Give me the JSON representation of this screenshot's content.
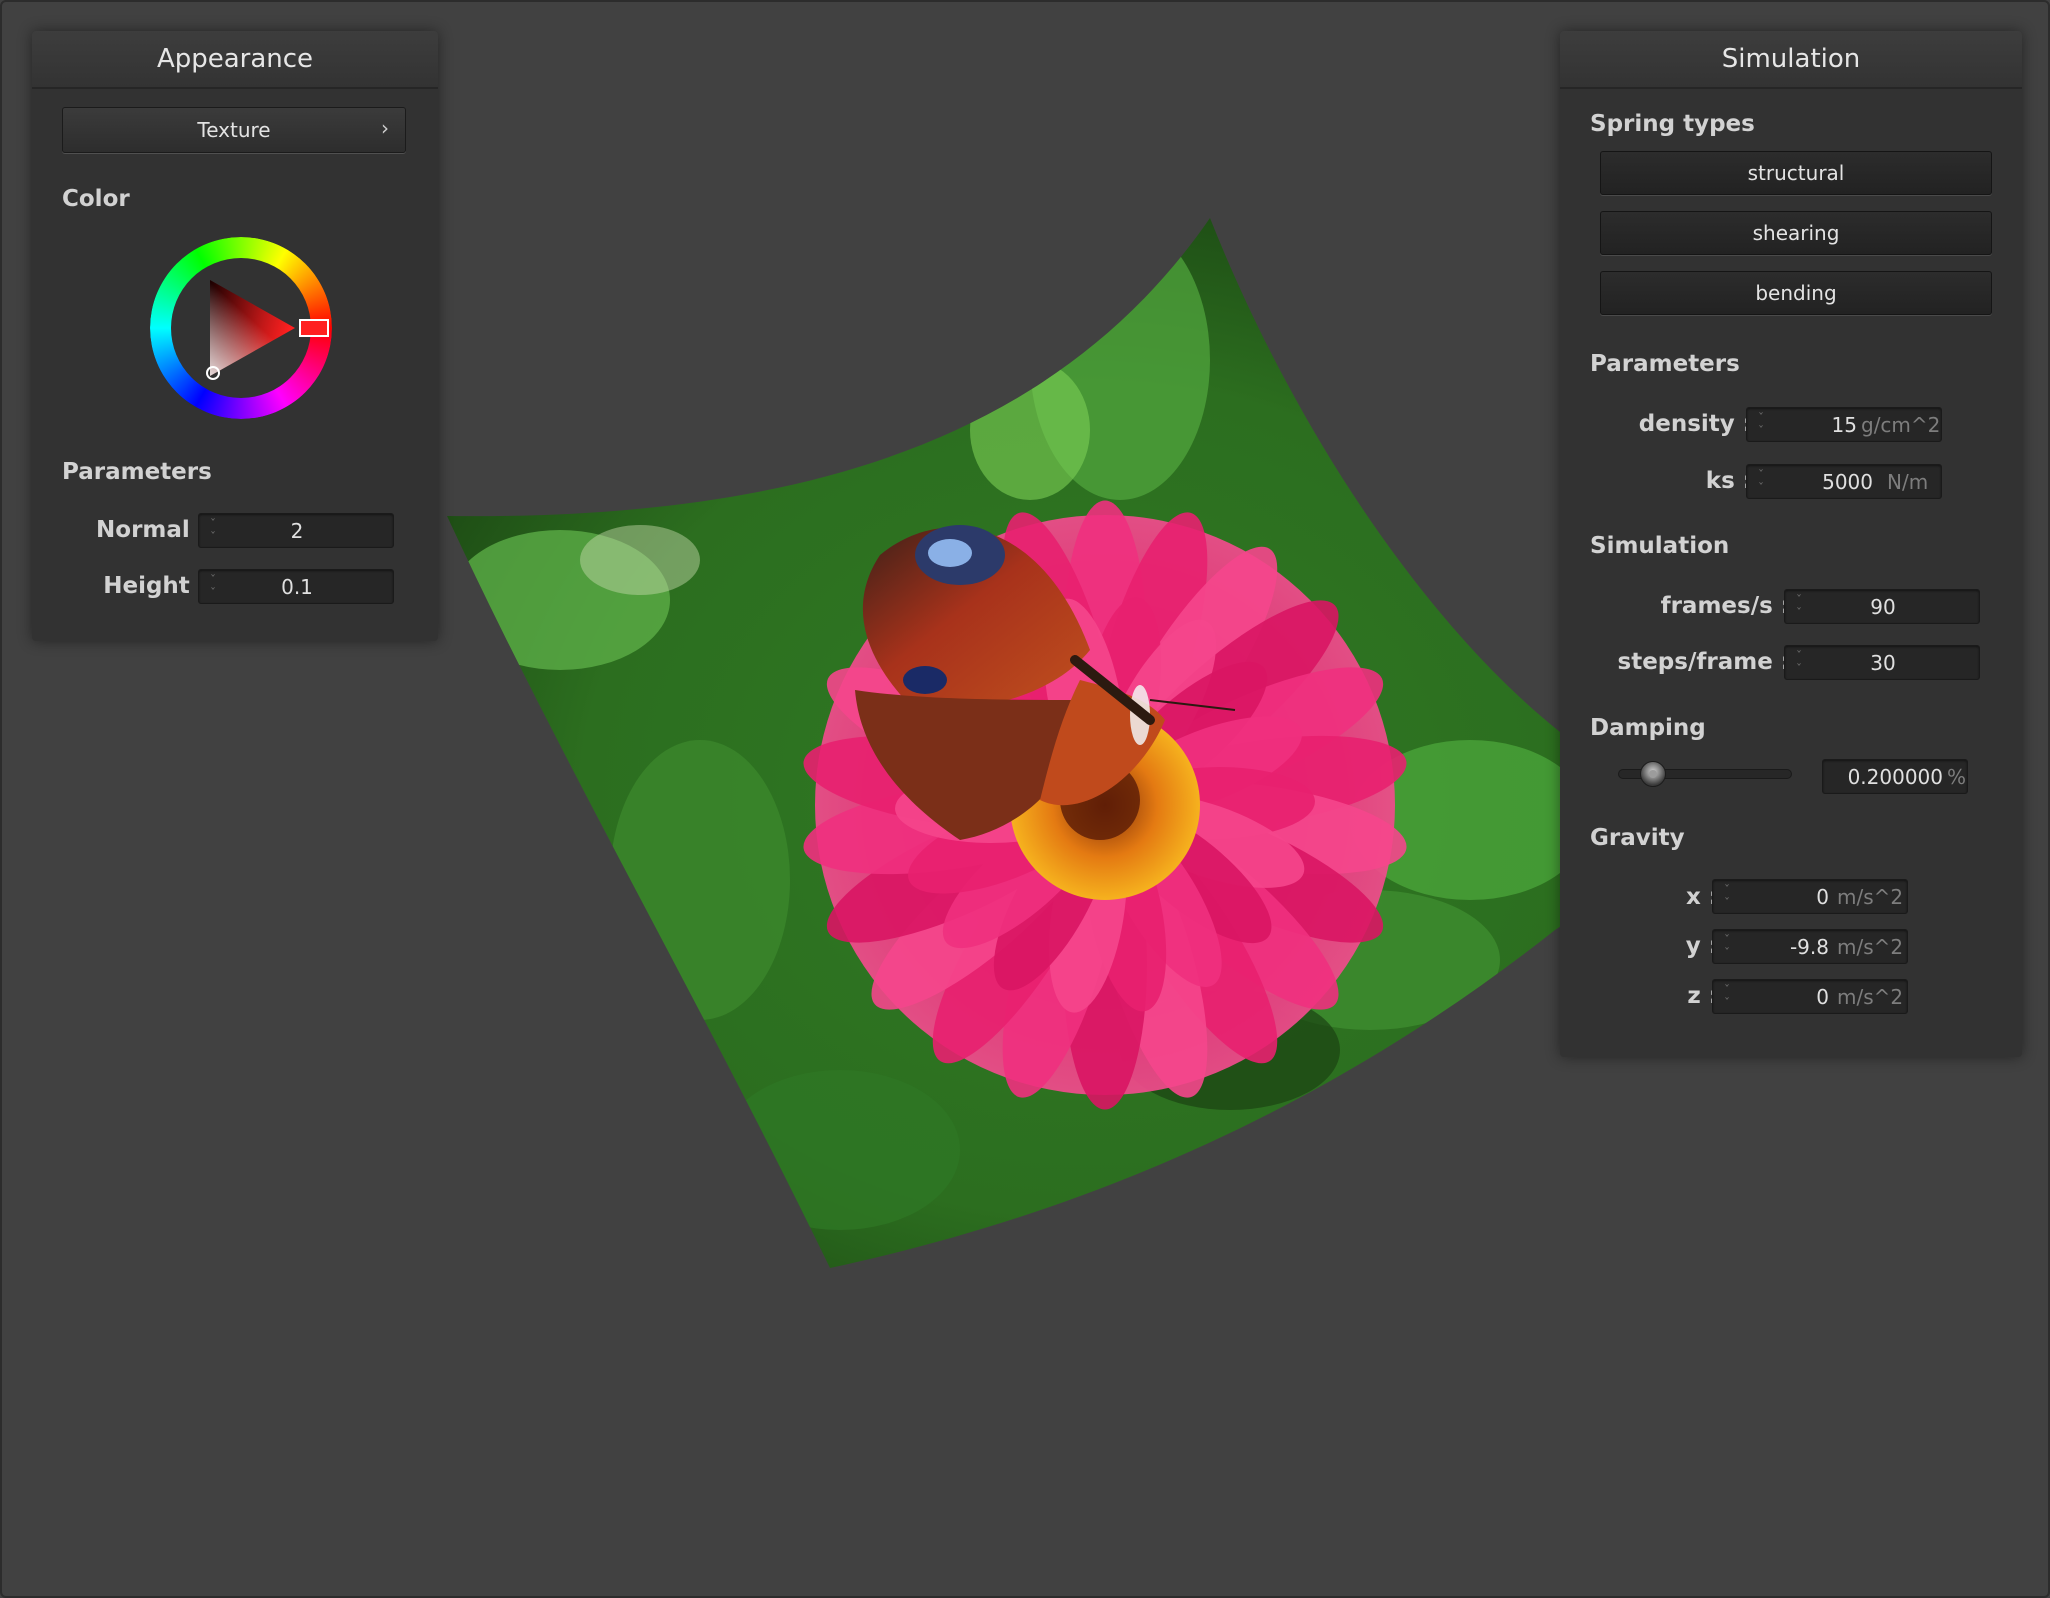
{
  "appearance": {
    "title": "Appearance",
    "texture_button": "Texture",
    "color_title": "Color",
    "color_value": "#ff2020",
    "parameters_title": "Parameters",
    "normal": {
      "label": "Normal :",
      "value": "2"
    },
    "height": {
      "label": "Height :",
      "value": "0.1"
    }
  },
  "simulation_panel": {
    "title": "Simulation",
    "spring_types": {
      "title": "Spring types",
      "buttons": [
        "structural",
        "shearing",
        "bending"
      ]
    },
    "parameters": {
      "title": "Parameters",
      "density": {
        "label": "density :",
        "value": "15",
        "unit": "g/cm^2"
      },
      "ks": {
        "label": "ks :",
        "value": "5000",
        "unit": "N/m"
      }
    },
    "simulation": {
      "title": "Simulation",
      "frames": {
        "label": "frames/s :",
        "value": "90"
      },
      "steps": {
        "label": "steps/frame :",
        "value": "30"
      }
    },
    "damping": {
      "title": "Damping",
      "value": "0.200000",
      "unit": "%",
      "slider_fraction": 0.2
    },
    "gravity": {
      "title": "Gravity",
      "x": {
        "label": "x :",
        "value": "0",
        "unit": "m/s^2"
      },
      "y": {
        "label": "y :",
        "value": "-9.8",
        "unit": "m/s^2"
      },
      "z": {
        "label": "z :",
        "value": "0",
        "unit": "m/s^2"
      }
    }
  },
  "cloth": {
    "texture": "butterfly-on-pink-flower"
  }
}
